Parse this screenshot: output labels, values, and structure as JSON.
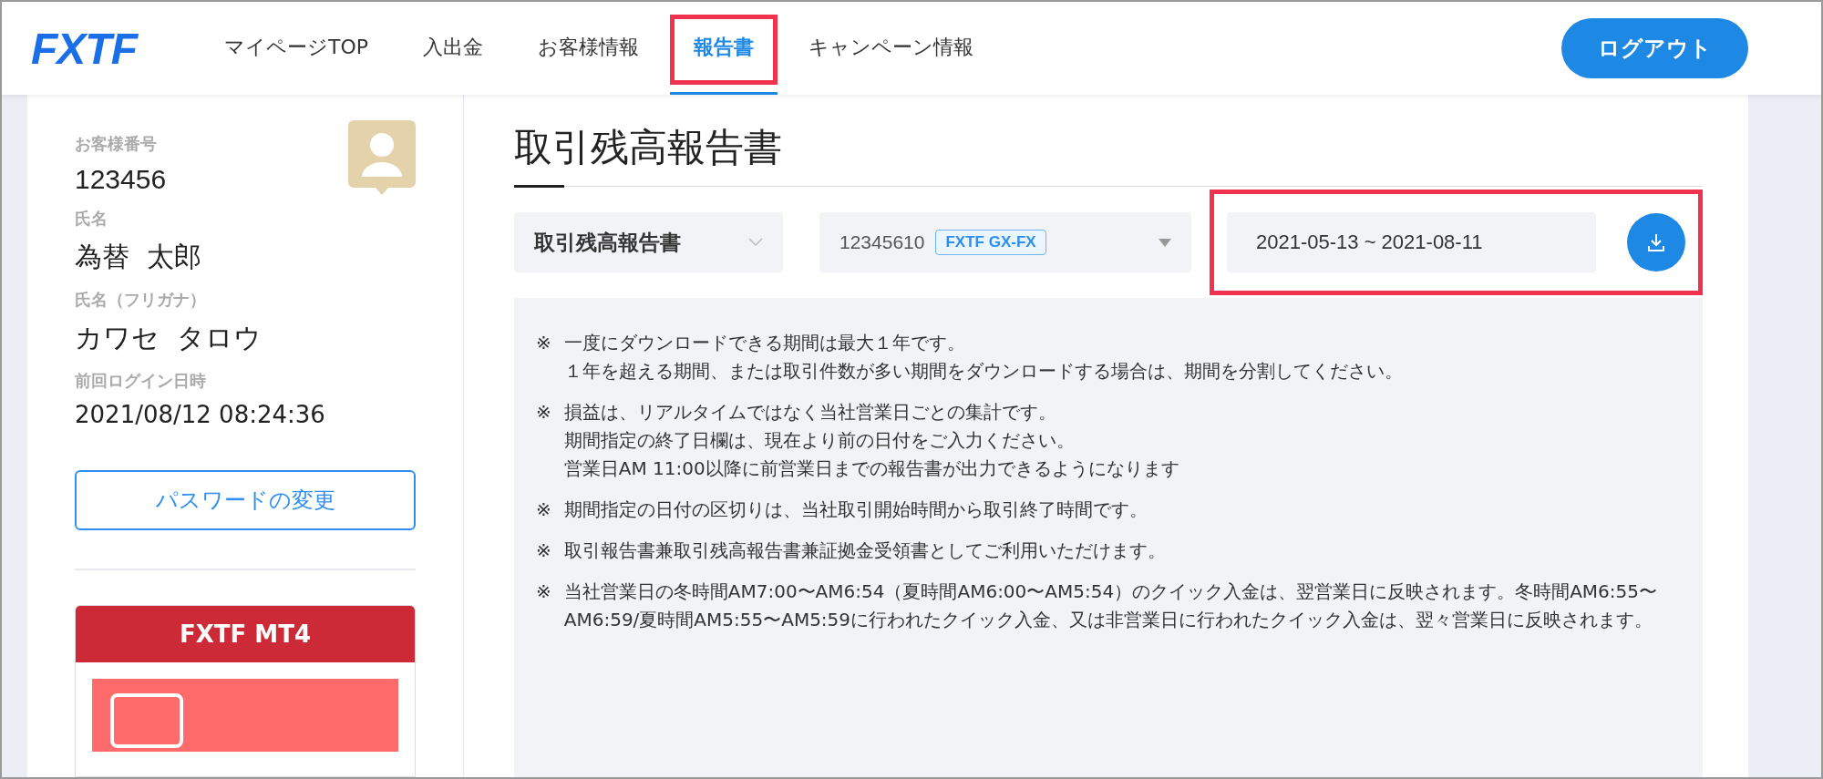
{
  "header": {
    "logo": "FXTF",
    "nav": [
      {
        "label": "マイページTOP",
        "selected": false,
        "highlighted": false
      },
      {
        "label": "入出金",
        "selected": false,
        "highlighted": false
      },
      {
        "label": "お客様情報",
        "selected": false,
        "highlighted": false
      },
      {
        "label": "報告書",
        "selected": true,
        "highlighted": true
      },
      {
        "label": "キャンペーン情報",
        "selected": false,
        "highlighted": false
      }
    ],
    "logout": "ログアウト"
  },
  "sidebar": {
    "fields": [
      {
        "label": "お客様番号",
        "value": "123456",
        "kind": "number"
      },
      {
        "label": "氏名",
        "value": "為替  太郎",
        "kind": "name"
      },
      {
        "label": "氏名（フリガナ）",
        "value": "カワセ  タロウ",
        "kind": "name"
      },
      {
        "label": "前回ログイン日時",
        "value": "2021/08/12 08:24:36",
        "kind": "date"
      }
    ],
    "password_button": "パスワードの変更",
    "card_title": "FXTF MT4"
  },
  "main": {
    "title": "取引残高報告書",
    "report_type": "取引残高報告書",
    "account": "12345610",
    "account_tag": "FXTF GX-FX",
    "date_range": "2021-05-13 ~ 2021-08-11",
    "date_highlighted": true,
    "notes": [
      {
        "mark": "※",
        "lines": [
          "一度にダウンロードできる期間は最大１年です。",
          "１年を超える期間、または取引件数が多い期間をダウンロードする場合は、期間を分割してください。"
        ]
      },
      {
        "mark": "※",
        "lines": [
          "損益は、リアルタイムではなく当社営業日ごとの集計です。",
          "期間指定の終了日欄は、現在より前の日付をご入力ください。",
          "営業日AM 11:00以降に前営業日までの報告書が出力できるようになります"
        ]
      },
      {
        "mark": "※",
        "lines": [
          "期間指定の日付の区切りは、当社取引開始時間から取引終了時間です。"
        ]
      },
      {
        "mark": "※",
        "lines": [
          "取引報告書兼取引残高報告書兼証拠金受領書としてご利用いただけます。"
        ]
      },
      {
        "mark": "※",
        "lines": [
          "当社営業日の冬時間AM7:00〜AM6:54（夏時間AM6:00〜AM5:54）のクイック入金は、翌営業日に反映されます。冬時間AM6:55〜AM6:59/夏時間AM5:55〜AM5:59に行われたクイック入金、又は非営業日に行われたクイック入金は、翌々営業日に反映されます。"
        ]
      }
    ]
  }
}
